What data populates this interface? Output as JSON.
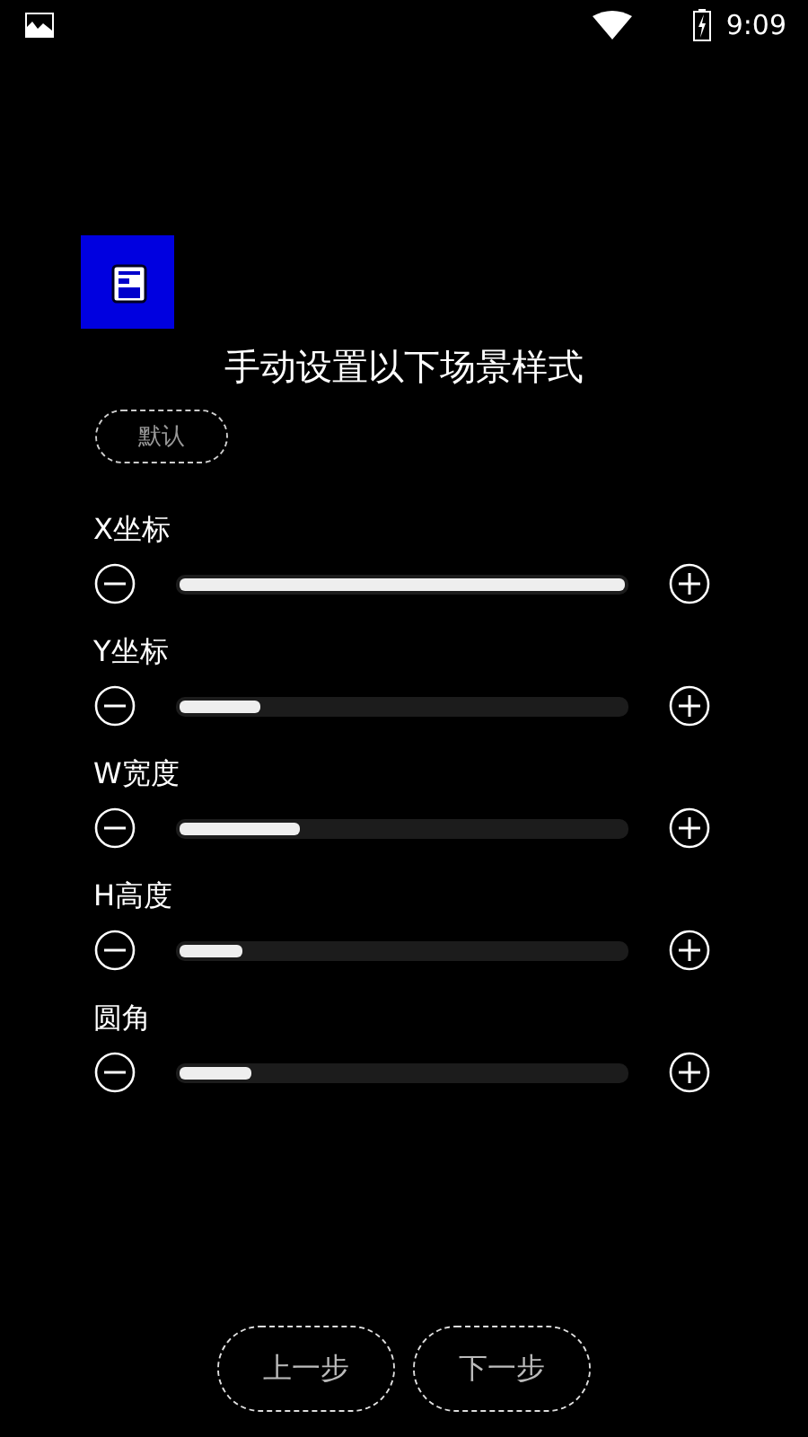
{
  "status_bar": {
    "time": "9:09"
  },
  "title": "手动设置以下场景样式",
  "default_button": "默认",
  "sliders": [
    {
      "label": "X坐标",
      "level": 1.0
    },
    {
      "label": "Y坐标",
      "level": 0.18
    },
    {
      "label": "W宽度",
      "level": 0.27
    },
    {
      "label": "H高度",
      "level": 0.14
    },
    {
      "label": "圆角",
      "level": 0.16
    }
  ],
  "buttons": [
    "上一步",
    "下一步"
  ]
}
